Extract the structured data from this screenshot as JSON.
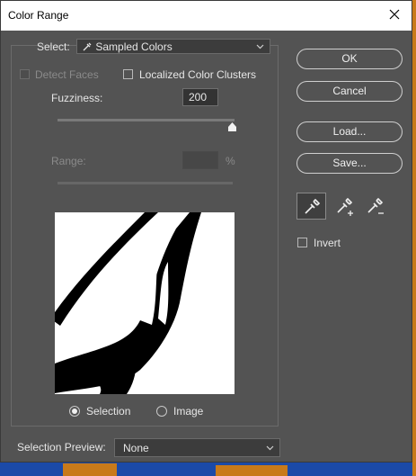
{
  "dialog": {
    "title": "Color Range",
    "buttons": {
      "ok": "OK",
      "cancel": "Cancel",
      "load": "Load...",
      "save": "Save..."
    }
  },
  "select": {
    "label": "Select:",
    "value": "Sampled Colors"
  },
  "options": {
    "detect_faces": {
      "label": "Detect Faces",
      "checked": false,
      "enabled": false
    },
    "localized_color_clusters": {
      "label": "Localized Color Clusters",
      "checked": false
    }
  },
  "fuzziness": {
    "label": "Fuzziness:",
    "value": "200",
    "slider_fraction": 1.0
  },
  "range": {
    "label": "Range:",
    "value": "",
    "unit": "%",
    "enabled": false
  },
  "preview_mode": {
    "selection_label": "Selection",
    "image_label": "Image",
    "selected": "Selection"
  },
  "eyedroppers": [
    "eyedropper-icon",
    "eyedropper-plus-icon",
    "eyedropper-minus-icon"
  ],
  "invert": {
    "label": "Invert",
    "checked": false
  },
  "selection_preview": {
    "label": "Selection Preview:",
    "value": "None"
  },
  "colors": {
    "dialog_bg": "#535353",
    "desktop_bg": "#1b4aa8",
    "desktop_accent": "#c87a1a"
  }
}
